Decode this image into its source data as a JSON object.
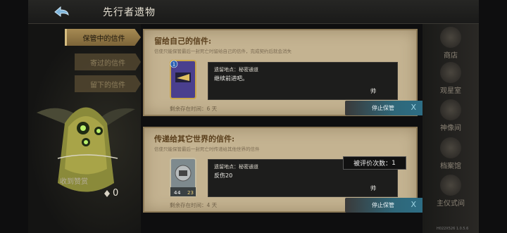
{
  "header": {
    "title": "先行者遗物"
  },
  "tabs": [
    {
      "label": "保管中的信件",
      "active": true
    },
    {
      "label": "寄过的信件",
      "active": false
    },
    {
      "label": "留下的信件",
      "active": false
    }
  ],
  "received": {
    "label": "收到赞赏",
    "count": "0"
  },
  "letters": [
    {
      "heading": "留给自己的信件:",
      "desc": "信使只能保管最后一封死亡时留给自己的信件，完成契约后就会消失",
      "card_cost": "1",
      "location": "遗留地点：秘密通道",
      "message": "继续前进吧。",
      "signature": "帅",
      "remain": "剩余存在时间：6 天",
      "stop_label": "停止保管",
      "stop_icon": "X"
    },
    {
      "heading": "传递给其它世界的信件:",
      "desc": "信使只能保管最后一封死亡时传递给其他世界的信件",
      "card_stats": [
        "4",
        "4",
        "23"
      ],
      "location": "遗留地点：秘密通道",
      "message": "反伤20",
      "signature": "帅",
      "remain": "剩余存在时间：4 天",
      "stop_label": "停止保管",
      "stop_icon": "X",
      "rated_label": "被评价次数：",
      "rated_count": "1"
    }
  ],
  "nav": [
    {
      "label": "商店"
    },
    {
      "label": "观星室"
    },
    {
      "label": "神像间"
    },
    {
      "label": "档案馆"
    },
    {
      "label": "主仪式间"
    }
  ],
  "version": "H022X526 1.0.5.6",
  "colors": {
    "accent": "#2d6e86",
    "parchment": "#c4b391",
    "tab_active": "#a68a53"
  }
}
